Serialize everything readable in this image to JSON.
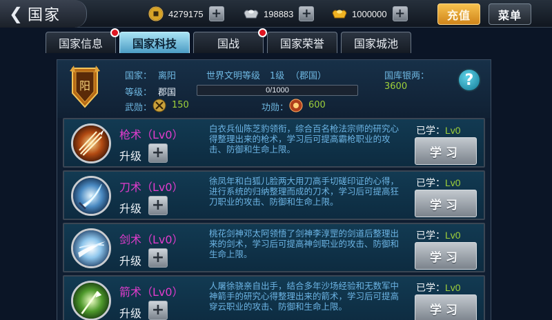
{
  "header": {
    "title": "国家",
    "resources": [
      {
        "name": "copper",
        "icon": "coin-icon",
        "value": "4279175"
      },
      {
        "name": "silver",
        "icon": "silver-ingot-icon",
        "value": "198883"
      },
      {
        "name": "gold",
        "icon": "gold-ingot-icon",
        "value": "1000000"
      }
    ],
    "recharge_label": "充值",
    "menu_label": "菜单"
  },
  "tabs": [
    {
      "label": "国家信息",
      "active": false,
      "badge": true
    },
    {
      "label": "国家科技",
      "active": true,
      "badge": false
    },
    {
      "label": "国战",
      "active": false,
      "badge": true
    },
    {
      "label": "国家荣誉",
      "active": false,
      "badge": false
    },
    {
      "label": "国家城池",
      "active": false,
      "badge": false
    }
  ],
  "country": {
    "emblem_char": "阳",
    "name_label": "国家：",
    "name": "离阳",
    "level_label": "等级：",
    "level": "郡国",
    "merit_label": "武勋：",
    "merit_value": "150",
    "civilization_label": "世界文明等级",
    "civilization_level": "1级",
    "civilization_rank": "（郡国）",
    "exp_current": 0,
    "exp_max": 1000,
    "exp_text": "0/1000",
    "contribution_label": "功勋：",
    "contribution_value": "600",
    "treasury_label": "国库银两：",
    "treasury_value": "3600"
  },
  "skills_common": {
    "upgrade_label": "升级",
    "learned_label": "已学：",
    "learn_button": "学习"
  },
  "skills": [
    {
      "name": "枪术（Lv0）",
      "icon": "spear-skill-icon",
      "description": "白衣兵仙陈芝豹领衔，综合百名枪法宗师的研究心得整理出来的枪术，学习后可提高霸枪职业的攻击、防御和生命上限。",
      "level": "Lv0"
    },
    {
      "name": "刀术（Lv0）",
      "icon": "blade-skill-icon",
      "description": "徐凤年和白狐儿脸两大用刀高手切磋印证的心得，进行系统的归纳整理而成的刀术，学习后可提高狂刀职业的攻击、防御和生命上限。",
      "level": "Lv0"
    },
    {
      "name": "剑术（Lv0）",
      "icon": "sword-skill-icon",
      "description": "桃花剑神邓太阿领悟了剑神李淳罡的剑道后整理出来的剑术，学习后可提高神剑职业的攻击、防御和生命上限。",
      "level": "Lv0"
    },
    {
      "name": "箭术（Lv0）",
      "icon": "arrow-skill-icon",
      "description": "人屠徐骁亲自出手，结合多年沙场经验和无数军中神箭手的研究心得整理出来的箭术，学习后可提高穿云职业的攻击、防御和生命上限。",
      "level": "Lv0"
    }
  ],
  "colors": {
    "accent_active_tab": "#7cc6e4",
    "skill_name": "#e23ccd",
    "description": "#6cb4e4",
    "value_green": "#9fd13a",
    "badge_red": "#e01622",
    "recharge": "#e3a030"
  }
}
